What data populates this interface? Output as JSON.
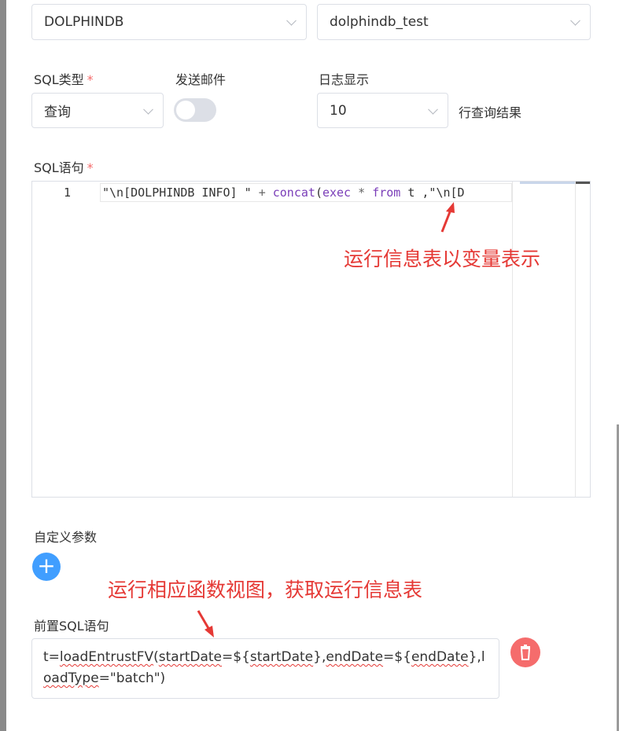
{
  "datasource": {
    "type_value": "DOLPHINDB",
    "name_value": "dolphindb_test"
  },
  "sql_type": {
    "label": "SQL类型",
    "required_mark": "*",
    "value": "查询"
  },
  "send_email": {
    "label": "发送邮件",
    "enabled": false
  },
  "log_display": {
    "label": "日志显示",
    "value": "10",
    "suffix": "行查询结果"
  },
  "sql_statement": {
    "label": "SQL语句",
    "required_mark": "*",
    "line_number": "1",
    "code_tokens": [
      "\"\\n[DOLPHINDB INFO] \" ",
      "+",
      " ",
      "concat",
      "(",
      "exec",
      " ",
      "*",
      " ",
      "from",
      " t ,\"\\n[D"
    ]
  },
  "custom_params": {
    "label": "自定义参数",
    "add_symbol": "+"
  },
  "pre_sql": {
    "label": "前置SQL语句",
    "value_parts": [
      "t=",
      "loadEntrustFV",
      "(",
      "startDate",
      "=${",
      "startDate",
      "},",
      "endDate",
      "=${",
      "endDate",
      "},l",
      "oadType",
      "=\"batch\")"
    ]
  },
  "annotations": {
    "top": "运行信息表以变量表示",
    "bottom": "运行相应函数视图，获取运行信息表"
  },
  "colors": {
    "accent": "#409eff",
    "danger": "#f56c6c",
    "annotation": "#e53935"
  },
  "icons": [
    "chevron-down-icon",
    "plus-icon",
    "trash-icon",
    "arrow-icon"
  ]
}
